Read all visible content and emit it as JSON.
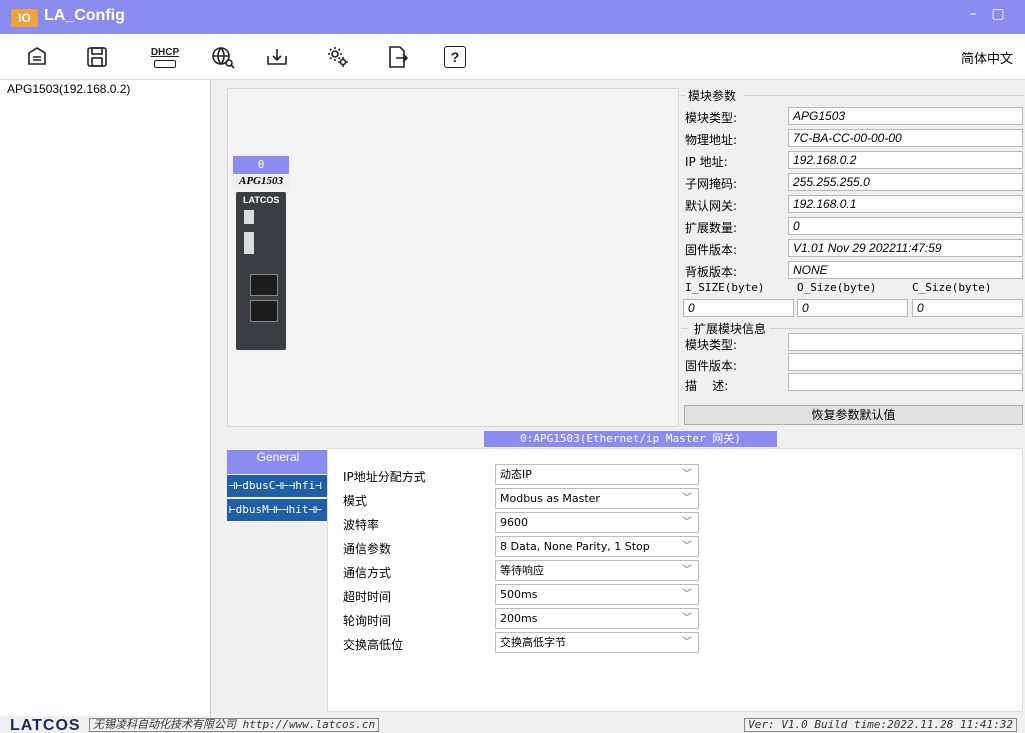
{
  "titlebar": {
    "logo": "IO",
    "title": "LA_Config",
    "minimize": "–",
    "maximize": "▢"
  },
  "toolbar": {
    "icons": [
      "scan-icon",
      "save-icon",
      "dhcp-icon",
      "network-search-icon",
      "download-icon",
      "settings-icon",
      "export-icon",
      "help-icon"
    ],
    "dhcp_label": "DHCP",
    "help_label": "?",
    "language": "简体中文"
  },
  "tree": {
    "items": [
      {
        "label": "APG1503(192.168.0.2)"
      }
    ]
  },
  "module": {
    "slot": "0",
    "name": "APG1503",
    "brand": "LATCOS"
  },
  "params": {
    "group_title": "模块参数",
    "rows": [
      {
        "label": "模块类型:",
        "value": "APG1503"
      },
      {
        "label": "物理地址:",
        "value": "7C-BA-CC-00-00-00"
      },
      {
        "label": "IP 地址:",
        "value": "192.168.0.2"
      },
      {
        "label": "子网掩码:",
        "value": "255.255.255.0"
      },
      {
        "label": "默认网关:",
        "value": "192.168.0.1"
      },
      {
        "label": "扩展数量:",
        "value": "0"
      },
      {
        "label": "固件版本:",
        "value": "V1.01 Nov 29 202211:47:59"
      },
      {
        "label": "背板版本:",
        "value": "NONE"
      }
    ],
    "size_headers": [
      "I_SIZE(byte)",
      "O_Size(byte)",
      "C_Size(byte)"
    ],
    "size_values": [
      "0",
      "0",
      "0"
    ],
    "ext_group_title": "扩展模块信息",
    "ext_rows": [
      {
        "label": "模块类型:",
        "value": ""
      },
      {
        "label": "固件版本:",
        "value": ""
      },
      {
        "label": "描    述:",
        "value": ""
      }
    ],
    "restore_button": "恢复参数默认值"
  },
  "status_strip": "0:APG1503(Ethernet/ip Master 网关)",
  "tabs": [
    {
      "label": "General"
    },
    {
      "label": "⊣⊢dbusC⊣⊢⊣hfi⊣"
    },
    {
      "label": "⊢dbusM⊣⊢⊣hit⊣⊢"
    }
  ],
  "config": {
    "rows": [
      {
        "label": "IP地址分配方式",
        "value": "动态IP"
      },
      {
        "label": "模式",
        "value": "Modbus as Master"
      },
      {
        "label": "波特率",
        "value": "9600"
      },
      {
        "label": "通信参数",
        "value": "8 Data, None Parity, 1 Stop"
      },
      {
        "label": "通信方式",
        "value": "等待响应"
      },
      {
        "label": "超时时间",
        "value": "500ms"
      },
      {
        "label": "轮询时间",
        "value": "200ms"
      },
      {
        "label": "交换高低位",
        "value": "交换高低字节"
      }
    ]
  },
  "footer": {
    "logo": "LATCOS",
    "company": "无锡凌科自动化技术有限公司 http://www.latcos.cn",
    "version": "Ver: V1.0 Build time:2022.11.28 11:41:32"
  },
  "colors": {
    "accent": "#8a8cf0",
    "tab_blue": "#1e5fa8"
  }
}
